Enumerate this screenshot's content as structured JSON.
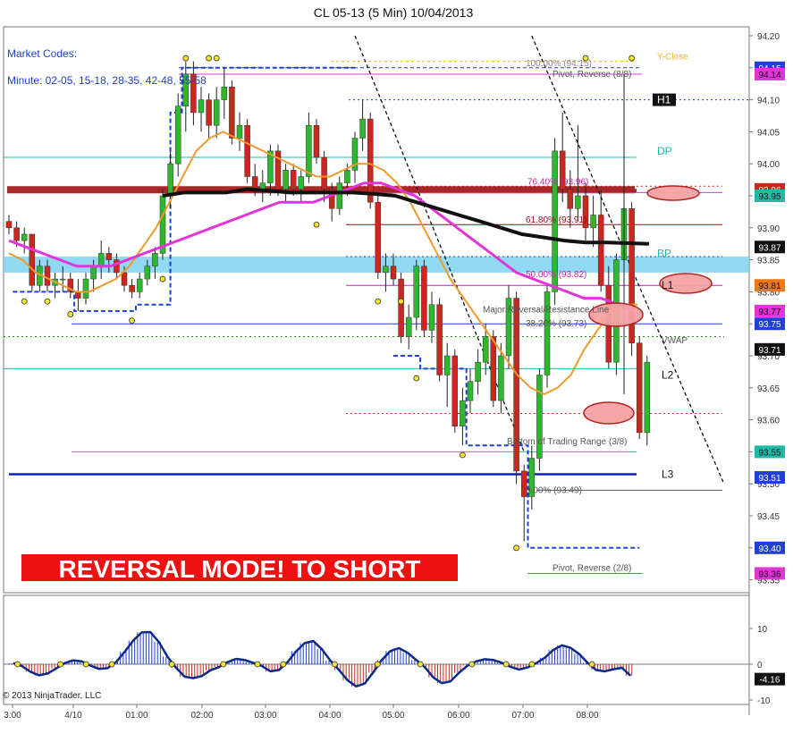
{
  "header": {
    "title": "CL 05-13 (5 Min)  10/04/2013"
  },
  "info": {
    "market_codes": "Market Codes:",
    "minute_codes": "Minute: 02-05, 15-18, 28-35, 42-48, 55-58"
  },
  "banner": "REVERSAL MODE! TO SHORT",
  "copyright": "© 2013 NinjaTrader, LLC",
  "colors": {
    "up_candle": "#2db82d",
    "down_candle": "#c8281e",
    "orange_ma": "#ef9a2d",
    "magenta_ma": "#e234d8",
    "black_ma": "#111111",
    "stop_line": "#1f3fd6",
    "banner_bg": "#ee1111",
    "resistance": "#a82828",
    "support_band": "#7fd2f2"
  },
  "chart_data": [
    {
      "type": "candlestick",
      "title": "CL 05-13 (5 Min)  10/04/2013",
      "ylim": [
        93.34,
        94.22
      ],
      "y_ticks": [
        "94.20",
        "94.15",
        "94.10",
        "94.05",
        "94.00",
        "93.95",
        "93.90",
        "93.85",
        "93.80",
        "93.75",
        "93.70",
        "93.65",
        "93.60",
        "93.55",
        "93.50",
        "93.45",
        "93.40",
        "93.35"
      ],
      "x_ticks": [
        "3:00",
        "4/10",
        "01:00",
        "02:00",
        "03:00",
        "04:00",
        "05:00",
        "06:00",
        "07:00",
        "08:00"
      ],
      "candles": [
        [
          93.91,
          93.92,
          93.89,
          93.9
        ],
        [
          93.9,
          93.91,
          93.87,
          93.88
        ],
        [
          93.88,
          93.9,
          93.86,
          93.89
        ],
        [
          93.89,
          93.89,
          93.8,
          93.81
        ],
        [
          93.81,
          93.85,
          93.8,
          93.84
        ],
        [
          93.84,
          93.85,
          93.8,
          93.81
        ],
        [
          93.81,
          93.83,
          93.79,
          93.82
        ],
        [
          93.82,
          93.84,
          93.8,
          93.82
        ],
        [
          93.82,
          93.83,
          93.79,
          93.8
        ],
        [
          93.8,
          93.82,
          93.77,
          93.79
        ],
        [
          93.79,
          93.83,
          93.78,
          93.82
        ],
        [
          93.82,
          93.85,
          93.8,
          93.84
        ],
        [
          93.84,
          93.88,
          93.82,
          93.86
        ],
        [
          93.86,
          93.87,
          93.83,
          93.85
        ],
        [
          93.85,
          93.86,
          93.82,
          93.83
        ],
        [
          93.83,
          93.84,
          93.8,
          93.81
        ],
        [
          93.81,
          93.82,
          93.79,
          93.8
        ],
        [
          93.8,
          93.83,
          93.79,
          93.82
        ],
        [
          93.82,
          93.85,
          93.81,
          93.84
        ],
        [
          93.84,
          93.87,
          93.82,
          93.86
        ],
        [
          93.86,
          93.96,
          93.85,
          93.95
        ],
        [
          93.95,
          94.02,
          93.93,
          94.0
        ],
        [
          94.0,
          94.11,
          93.98,
          94.09
        ],
        [
          94.09,
          94.16,
          94.05,
          94.14
        ],
        [
          94.14,
          94.16,
          94.06,
          94.08
        ],
        [
          94.08,
          94.12,
          94.05,
          94.1
        ],
        [
          94.1,
          94.11,
          94.04,
          94.06
        ],
        [
          94.06,
          94.12,
          94.04,
          94.1
        ],
        [
          94.1,
          94.15,
          94.07,
          94.12
        ],
        [
          94.12,
          94.13,
          94.03,
          94.04
        ],
        [
          94.04,
          94.08,
          94.02,
          94.06
        ],
        [
          94.06,
          94.07,
          93.97,
          93.98
        ],
        [
          93.98,
          94.0,
          93.95,
          93.96
        ],
        [
          93.96,
          93.99,
          93.94,
          93.97
        ],
        [
          93.97,
          94.03,
          93.95,
          94.02
        ],
        [
          94.02,
          94.03,
          93.95,
          93.96
        ],
        [
          93.96,
          94.0,
          93.94,
          93.99
        ],
        [
          93.99,
          94.0,
          93.95,
          93.96
        ],
        [
          93.96,
          93.99,
          93.94,
          93.98
        ],
        [
          93.98,
          94.08,
          93.97,
          94.06
        ],
        [
          94.06,
          94.07,
          94.0,
          94.01
        ],
        [
          94.01,
          94.02,
          93.94,
          93.96
        ],
        [
          93.96,
          93.97,
          93.91,
          93.93
        ],
        [
          93.93,
          93.98,
          93.92,
          93.97
        ],
        [
          93.97,
          94.0,
          93.95,
          93.99
        ],
        [
          93.99,
          94.05,
          93.97,
          94.04
        ],
        [
          94.04,
          94.1,
          94.02,
          94.07
        ],
        [
          94.07,
          94.08,
          93.93,
          93.94
        ],
        [
          93.94,
          93.95,
          93.82,
          93.83
        ],
        [
          93.83,
          93.86,
          93.8,
          93.84
        ],
        [
          93.84,
          93.86,
          93.81,
          93.82
        ],
        [
          93.82,
          93.83,
          93.72,
          93.73
        ],
        [
          93.73,
          93.78,
          93.71,
          93.76
        ],
        [
          93.76,
          93.85,
          93.74,
          93.84
        ],
        [
          93.84,
          93.85,
          93.73,
          93.74
        ],
        [
          93.74,
          93.8,
          93.72,
          93.78
        ],
        [
          93.78,
          93.79,
          93.66,
          93.67
        ],
        [
          93.67,
          93.72,
          93.62,
          93.7
        ],
        [
          93.7,
          93.71,
          93.58,
          93.59
        ],
        [
          93.59,
          93.65,
          93.56,
          93.63
        ],
        [
          93.63,
          93.68,
          93.61,
          93.66
        ],
        [
          93.66,
          93.71,
          93.64,
          93.69
        ],
        [
          93.69,
          93.75,
          93.67,
          93.73
        ],
        [
          93.73,
          93.74,
          93.62,
          93.63
        ],
        [
          93.63,
          93.72,
          93.61,
          93.7
        ],
        [
          93.7,
          93.81,
          93.68,
          93.79
        ],
        [
          93.79,
          93.8,
          93.5,
          93.52
        ],
        [
          93.52,
          93.53,
          93.41,
          93.48
        ],
        [
          93.48,
          93.56,
          93.46,
          93.54
        ],
        [
          93.54,
          93.68,
          93.52,
          93.67
        ],
        [
          93.67,
          93.81,
          93.65,
          93.8
        ],
        [
          93.8,
          94.04,
          93.78,
          94.02
        ],
        [
          94.02,
          94.08,
          93.94,
          93.96
        ],
        [
          93.96,
          93.99,
          93.9,
          93.93
        ],
        [
          93.93,
          94.06,
          93.91,
          93.95
        ],
        [
          93.95,
          93.97,
          93.88,
          93.9
        ],
        [
          93.9,
          93.95,
          93.87,
          93.92
        ],
        [
          93.92,
          93.96,
          93.8,
          93.81
        ],
        [
          93.81,
          93.84,
          93.68,
          93.69
        ],
        [
          93.69,
          93.86,
          93.67,
          93.85
        ],
        [
          93.85,
          94.13,
          93.83,
          93.93
        ],
        [
          93.93,
          93.94,
          93.7,
          93.72
        ],
        [
          93.72,
          93.73,
          93.57,
          93.58
        ],
        [
          93.58,
          93.7,
          93.56,
          93.69
        ]
      ],
      "moving_averages": [
        {
          "name": "orange",
          "values": [
            93.86,
            93.85,
            93.83,
            93.82,
            93.81,
            93.8,
            93.8,
            93.81,
            93.82,
            93.84,
            93.87,
            93.9,
            93.94,
            93.98,
            94.02,
            94.04,
            94.05,
            94.04,
            94.03,
            94.02,
            94.01,
            94.0,
            93.99,
            93.98,
            93.98,
            93.99,
            94.0,
            94.0,
            93.99,
            93.97,
            93.94,
            93.9,
            93.86,
            93.82,
            93.79,
            93.76,
            93.73,
            93.7,
            93.67,
            93.65,
            93.64,
            93.65,
            93.67,
            93.71,
            93.74,
            93.77,
            93.78,
            93.78
          ]
        },
        {
          "name": "magenta",
          "values": [
            93.88,
            93.87,
            93.86,
            93.85,
            93.84,
            93.84,
            93.84,
            93.85,
            93.86,
            93.87,
            93.88,
            93.89,
            93.9,
            93.91,
            93.92,
            93.93,
            93.94,
            93.94,
            93.94,
            93.95,
            93.96,
            93.97,
            93.97,
            93.96,
            93.95,
            93.93,
            93.91,
            93.89,
            93.87,
            93.85,
            93.83,
            93.82,
            93.81,
            93.8,
            93.79,
            93.79,
            93.78,
            93.77
          ]
        },
        {
          "name": "black",
          "values": [
            93.95,
            93.955,
            93.955,
            93.955,
            93.96,
            93.958,
            93.955,
            93.955,
            93.955,
            93.955,
            93.953,
            93.95,
            93.94,
            93.93,
            93.92,
            93.91,
            93.9,
            93.89,
            93.885,
            93.88,
            93.877,
            93.877,
            93.876,
            93.875
          ]
        }
      ],
      "price_labels": [
        {
          "value": "94.15",
          "color": "#1f3fd6"
        },
        {
          "value": "94.14",
          "color": "#e234d8"
        },
        {
          "value": "93.96",
          "color": "#c8281e"
        },
        {
          "value": "93.95",
          "color": "#22b8a8"
        },
        {
          "value": "93.87",
          "color": "#111111"
        },
        {
          "value": "93.81",
          "color": "#f07818"
        },
        {
          "value": "93.77",
          "color": "#e234d8"
        },
        {
          "value": "93.75",
          "color": "#1f3fd6"
        },
        {
          "value": "93.71",
          "color": "#111111"
        },
        {
          "value": "93.55",
          "color": "#22b8a8"
        },
        {
          "value": "93.51",
          "color": "#1f3fd6"
        },
        {
          "value": "93.40",
          "color": "#1f3fd6"
        },
        {
          "value": "93.36",
          "color": "#e234d8"
        }
      ],
      "annotations": [
        {
          "text": "Y-Close",
          "value": 94.16
        },
        {
          "text": "100.00% (94.15)",
          "value": 94.15
        },
        {
          "text": "Pivot, Reverse (8/8)",
          "value": 94.14
        },
        {
          "text": "H1",
          "value": 94.1
        },
        {
          "text": "DP",
          "value": 94.01
        },
        {
          "text": "76.40% (93.96)",
          "value": 93.965
        },
        {
          "text": "61.80% (93.91)",
          "value": 93.905
        },
        {
          "text": "BP",
          "value": 93.85
        },
        {
          "text": "50.00% (93.82)",
          "value": 93.82
        },
        {
          "text": "L1",
          "value": 93.81
        },
        {
          "text": "Major Reversal/Resistance Line",
          "value": 93.765
        },
        {
          "text": "38.20% (93.73)",
          "value": 93.745
        },
        {
          "text": "VWAP",
          "value": 93.725
        },
        {
          "text": "L2",
          "value": 93.67
        },
        {
          "text": "Bottom of Trading Range (3/8)",
          "value": 93.56
        },
        {
          "text": "L3",
          "value": 93.515
        },
        {
          "text": "0.00% (93.49)",
          "value": 93.49
        },
        {
          "text": "Pivot, Reverse (2/8)",
          "value": 93.36
        }
      ]
    },
    {
      "type": "histogram",
      "ylim": [
        -10,
        18
      ],
      "y_ticks": [
        "10",
        "0",
        "-10"
      ],
      "last_value": "-4.16",
      "values": [
        0.3,
        -0.5,
        -2.1,
        -3.1,
        -2.6,
        -1.2,
        0.3,
        1.1,
        0.8,
        -0.4,
        -1.3,
        -1.1,
        0.6,
        3.5,
        6.6,
        8.9,
        9.0,
        6.2,
        2.1,
        -1.0,
        -3.5,
        -3.9,
        -3.3,
        -1.7,
        -0.8,
        0.6,
        1.5,
        1.2,
        0.4,
        -0.5,
        -2.0,
        -1.6,
        0.6,
        3.6,
        5.9,
        6.5,
        4.2,
        1.0,
        -1.6,
        -4.5,
        -6.2,
        -5.4,
        -2.3,
        1.2,
        3.7,
        4.5,
        3.2,
        1.2,
        -0.8,
        -3.7,
        -5.3,
        -4.8,
        -2.4,
        -0.4,
        0.8,
        1.4,
        1.2,
        0.4,
        -0.7,
        -1.5,
        -0.9,
        0.3,
        1.8,
        4.0,
        5.3,
        4.6,
        2.9,
        0.4,
        -1.6,
        -2.0,
        -1.4,
        -1.0,
        -3.2
      ]
    }
  ]
}
